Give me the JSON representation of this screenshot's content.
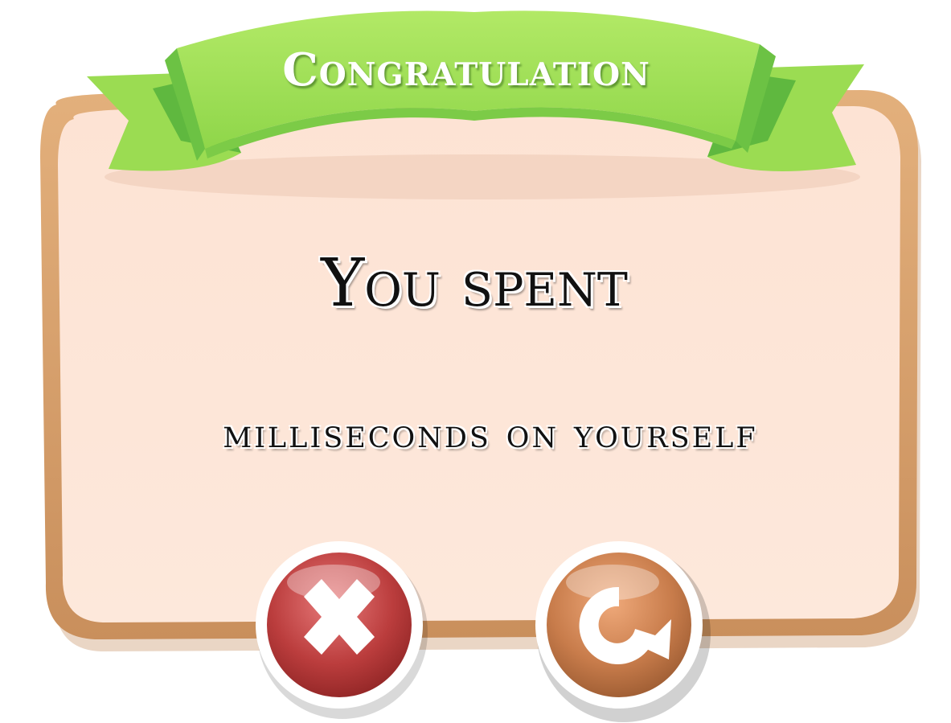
{
  "popup": {
    "banner_title": "Congratulation",
    "line1": "You spent",
    "line2": "milliseconds on yourself"
  },
  "buttons": {
    "close_icon": "close-x-icon",
    "restart_icon": "restart-arrow-icon"
  },
  "colors": {
    "panel_fill": "#fde4d6",
    "panel_border": "#d9a46e",
    "ribbon_light": "#a7e25a",
    "ribbon_dark": "#5fb83f",
    "close_button": "#b83a3a",
    "restart_button": "#c57a47"
  }
}
